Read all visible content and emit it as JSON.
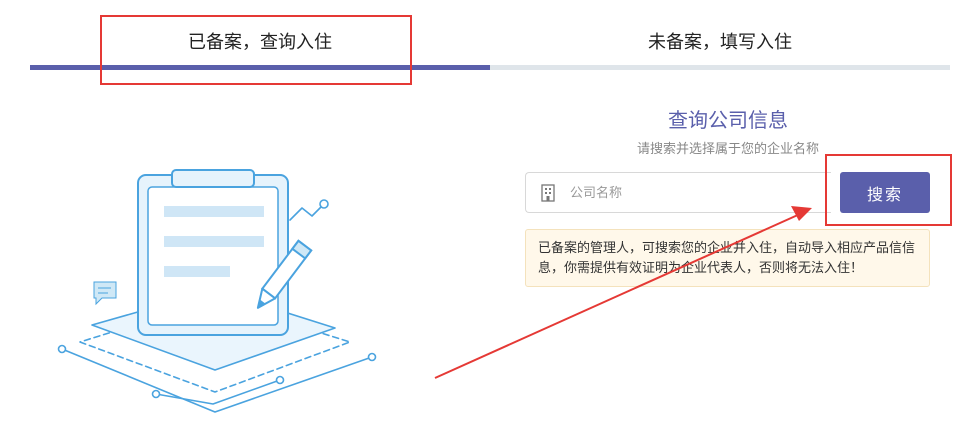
{
  "tabs": [
    {
      "label": "已备案，查询入住",
      "active": true
    },
    {
      "label": "未备案，填写入住",
      "active": false
    }
  ],
  "colors": {
    "accent": "#5a5fab",
    "annotation": "#e53935",
    "notice_bg": "#fff8ea",
    "illustration": "#4aa3df"
  },
  "search_panel": {
    "title": "查询公司信息",
    "subtitle": "请搜索并选择属于您的企业名称",
    "input_placeholder": "公司名称",
    "input_icon": "building-icon",
    "button_label": "搜索"
  },
  "notice": {
    "text": "已备案的管理人，可搜索您的企业并入住，自动导入相应产品信信息，你需提供有效证明为企业代表人，否则将无法入住！"
  },
  "illustration": {
    "icon": "clipboard-pencil-illustration"
  }
}
